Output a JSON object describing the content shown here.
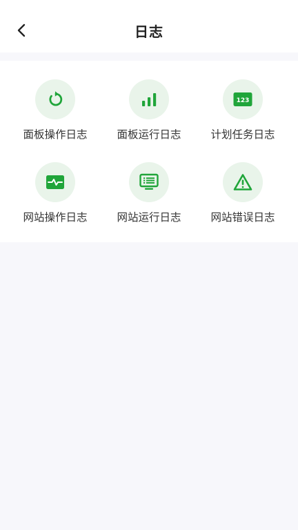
{
  "header": {
    "title": "日志"
  },
  "colors": {
    "accent": "#20a53a",
    "icon_bg": "#e9f4ea",
    "page_bg": "#f7f7fb"
  },
  "logs": [
    {
      "label": "面板操作日志",
      "icon": "refresh-icon"
    },
    {
      "label": "面板运行日志",
      "icon": "bar-chart-icon"
    },
    {
      "label": "计划任务日志",
      "icon": "numbers-123-icon"
    },
    {
      "label": "网站操作日志",
      "icon": "pulse-monitor-icon"
    },
    {
      "label": "网站运行日志",
      "icon": "list-screen-icon"
    },
    {
      "label": "网站错误日志",
      "icon": "warning-icon"
    }
  ],
  "icon_text": {
    "numbers": "123"
  }
}
